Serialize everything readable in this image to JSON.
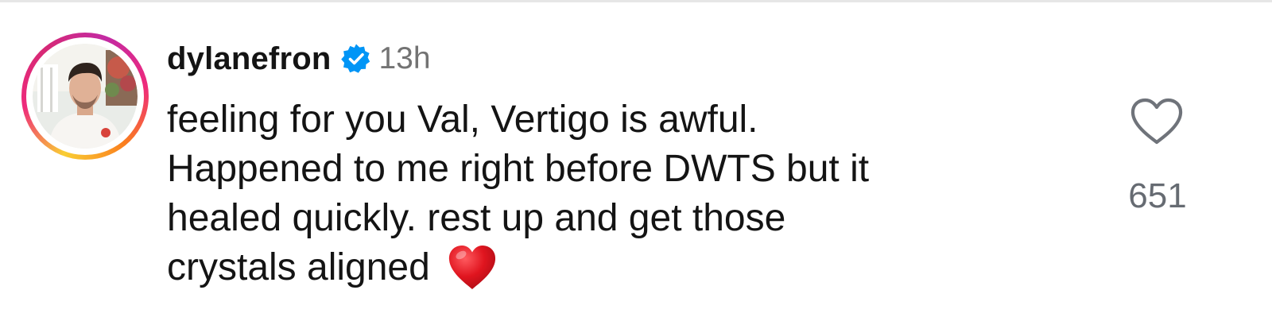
{
  "comment": {
    "username": "dylanefron",
    "verified": true,
    "timestamp": "13h",
    "lines": [
      "feeling for you Val, Vertigo is awful.",
      "Happened to me right before DWTS but it",
      "healed quickly. rest up and get those",
      "crystals aligned"
    ],
    "emoji": "red-heart-emoji",
    "like_icon": "heart-outline-icon",
    "verified_icon": "verified-badge-icon",
    "like_count": "651"
  },
  "colors": {
    "verified_blue": "#0095f6",
    "heart_red": "#e0151f",
    "text": "#141414",
    "muted": "#737373"
  }
}
